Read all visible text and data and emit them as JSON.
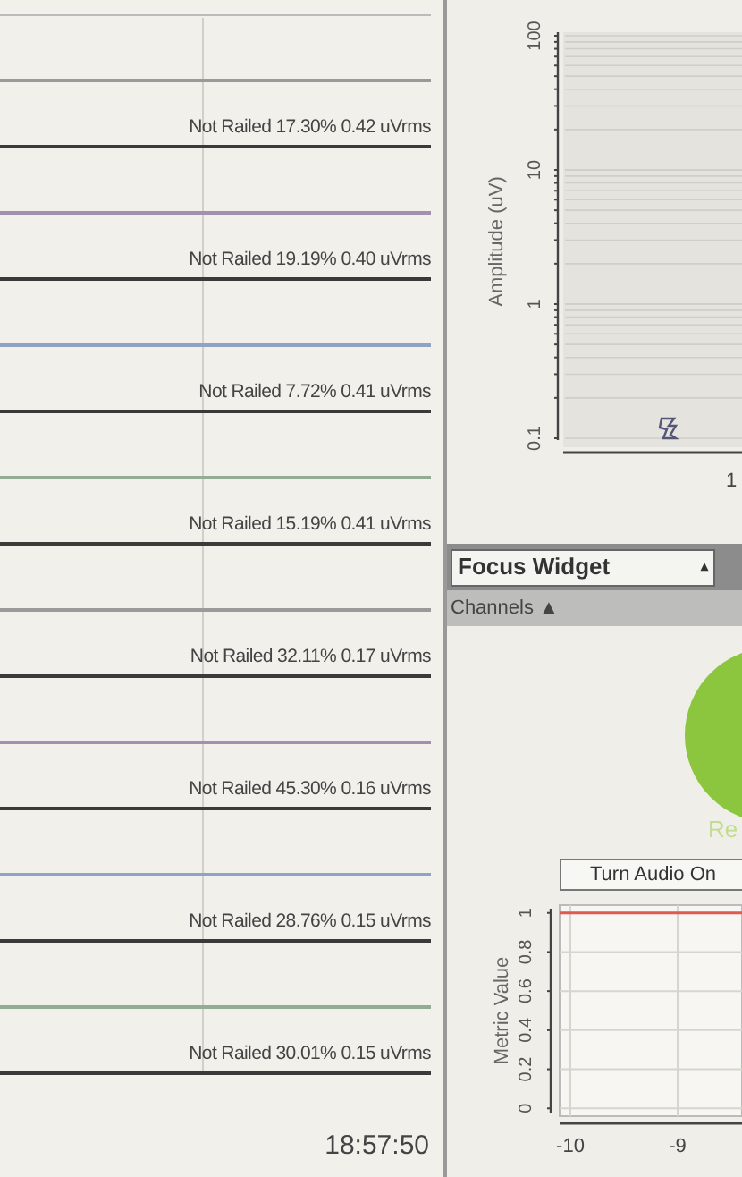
{
  "channels": [
    {
      "status": "Not Railed 17.30% 0.42 uVrms",
      "color": "#9a9a9a"
    },
    {
      "status": "Not Railed 19.19% 0.40 uVrms",
      "color": "#a58fb0"
    },
    {
      "status": "Not Railed 7.72% 0.41 uVrms",
      "color": "#8fa3c4"
    },
    {
      "status": "Not Railed 15.19% 0.41 uVrms",
      "color": "#93ad95"
    },
    {
      "status": "Not Railed 32.11% 0.17 uVrms",
      "color": "#9a9a9a"
    },
    {
      "status": "Not Railed 45.30% 0.16 uVrms",
      "color": "#a58fb0"
    },
    {
      "status": "Not Railed 28.76% 0.15 uVrms",
      "color": "#8fa3c4"
    },
    {
      "status": "Not Railed 30.01% 0.15 uVrms",
      "color": "#93ad95"
    }
  ],
  "timestamp": "18:57:50",
  "fft_chart": {
    "ylabel": "Amplitude (uV)",
    "y_tick_labels": [
      "0.1",
      "1",
      "10",
      "100"
    ],
    "x_tick_text": "1"
  },
  "focus_widget": {
    "dropdown": "Focus Widget",
    "dropdown_arrow": "▴",
    "channels_button": "Channels ▲",
    "status": "Re",
    "audio_button": "Turn Audio On",
    "chart_data": {
      "type": "line",
      "ylabel": "Metric Value",
      "x": [
        -10.1,
        -8.4
      ],
      "series": [
        {
          "color": "#e05a4f",
          "values": [
            1,
            1
          ]
        }
      ],
      "xlim": [
        -10.1,
        -8.4
      ],
      "ylim": [
        -0.04,
        1.04
      ],
      "xticks": [
        -10,
        -9
      ],
      "yticks": [
        0,
        0.2,
        0.4,
        0.6,
        0.8,
        1
      ],
      "grid": true
    }
  }
}
